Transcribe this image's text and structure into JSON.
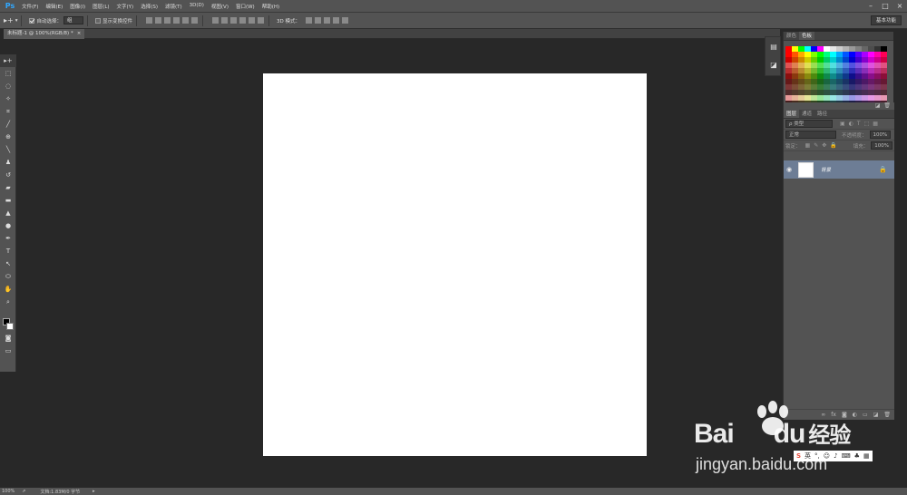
{
  "app": {
    "logo": "Ps"
  },
  "menu": [
    "文件(F)",
    "编辑(E)",
    "图像(I)",
    "图层(L)",
    "文字(Y)",
    "选择(S)",
    "滤镜(T)",
    "3D(D)",
    "视图(V)",
    "窗口(W)",
    "帮助(H)"
  ],
  "window_controls": [
    "–",
    "□",
    "×"
  ],
  "options_bar": {
    "auto_select_label": "自动选择：",
    "auto_select_value": "组",
    "show_transform_label": "显示变换控件",
    "mode_3d_label": "3D 模式：",
    "workspace": "基本功能"
  },
  "document_tab": {
    "title": "未标题-1 @ 100%(RGB/8) *",
    "close": "×"
  },
  "tools": [
    "move",
    "marquee",
    "lasso",
    "quick-select",
    "crop",
    "eyedropper",
    "healing",
    "brush",
    "stamp",
    "history-brush",
    "eraser",
    "gradient",
    "blur",
    "dodge",
    "pen",
    "type",
    "path-select",
    "shape",
    "hand",
    "zoom"
  ],
  "panels": {
    "color_tabs": [
      "颜色",
      "色板"
    ],
    "layer_tabs": [
      "图层",
      "通道",
      "路径"
    ],
    "filter_label": "ρ 类型",
    "blend_mode": "正常",
    "opacity_label": "不透明度：",
    "opacity_value": "100%",
    "lock_label": "锁定：",
    "fill_label": "填充：",
    "fill_value": "100%",
    "layer_name": "背景"
  },
  "status": {
    "zoom": "100%",
    "doc_info": "文档:1.83M/0 字节"
  },
  "watermark": {
    "brand": "Bai",
    "brand2": "du",
    "suffix": "经验",
    "url": "jingyan.baidu.com",
    "ime_label": "英"
  }
}
